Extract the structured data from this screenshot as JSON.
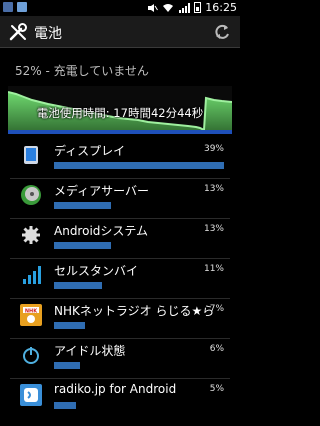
{
  "status_bar": {
    "time": "16:25"
  },
  "title_bar": {
    "title": "電池",
    "icon": "wrench-screwdriver-icon",
    "refresh_icon": "refresh-icon"
  },
  "summary": "52% - 充電していません",
  "graph": {
    "label": "電池使用時間: 17時間42分44秒",
    "line_color": "#7fe07f"
  },
  "usage": [
    {
      "label": "ディスプレイ",
      "percent_text": "39%",
      "percent": 39,
      "icon": "display-icon"
    },
    {
      "label": "メディアサーバー",
      "percent_text": "13%",
      "percent": 13,
      "icon": "media-server-icon"
    },
    {
      "label": "Androidシステム",
      "percent_text": "13%",
      "percent": 13,
      "icon": "gear-icon"
    },
    {
      "label": "セルスタンバイ",
      "percent_text": "11%",
      "percent": 11,
      "icon": "signal-icon"
    },
    {
      "label": "NHKネットラジオ らじる★ら",
      "percent_text": "7%",
      "percent": 7,
      "icon": "nhk-radio-app-icon"
    },
    {
      "label": "アイドル状態",
      "percent_text": "6%",
      "percent": 6,
      "icon": "power-icon"
    },
    {
      "label": "radiko.jp for Android",
      "percent_text": "5%",
      "percent": 5,
      "icon": "radiko-app-icon"
    }
  ],
  "colors": {
    "bar": "#2f6db3",
    "background": "#000000",
    "title_bar": "#1b1b1b"
  }
}
